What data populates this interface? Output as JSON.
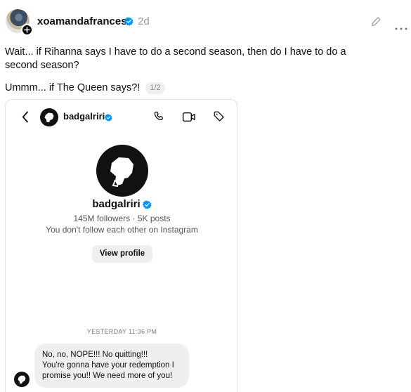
{
  "post": {
    "username": "xoamandafrances",
    "time": "2d",
    "text_line1": "Wait... if Rihanna says I have to do a second season, then do I have to do a",
    "text_line2": "second season?",
    "text_second": "Ummm... if The Queen says?!",
    "page_indicator": "1/2"
  },
  "dm": {
    "username": "badgalriri",
    "profile_name": "badgalriri",
    "stats": "145M followers · 5K posts",
    "follow_note": "You don't follow each other on Instagram",
    "view_profile_label": "View profile",
    "timestamp": "YESTERDAY 11:36 PM",
    "message": {
      "line1": "No, no, NOPE!!! No quitting!!!",
      "line2": "You're gonna have your redemption I",
      "line3": "promise you!! We need more of you!"
    }
  },
  "icons": {
    "verified": "verified-badge-icon",
    "edit": "pencil-icon",
    "more": "more-icon",
    "back": "chevron-left-icon",
    "phone": "phone-icon",
    "video": "video-icon",
    "tag": "tag-icon"
  },
  "colors": {
    "verified_blue": "#0095f6",
    "muted_text": "#999999",
    "bubble_gray": "#efefef"
  }
}
